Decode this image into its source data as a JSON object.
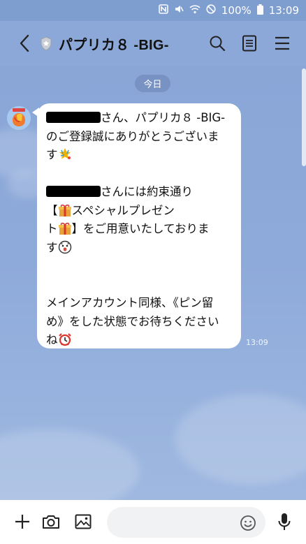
{
  "status_bar": {
    "battery_percent": "100%",
    "time": "13:09",
    "icons": [
      "nfc-icon",
      "mute-icon",
      "wifi-icon",
      "do-not-disturb-icon",
      "battery-icon"
    ]
  },
  "header": {
    "title": "パプリカ８ -BIG-",
    "icons": [
      "back-arrow-icon",
      "shield-icon",
      "search-icon",
      "notes-icon",
      "menu-icon"
    ]
  },
  "chat": {
    "date_label": "今日",
    "message": {
      "lines": [
        "さん、パプリカ８ -BIG-",
        "のご登録誠にありがとうございま",
        "す",
        "",
        "さんには約束通り",
        "【",
        "スペシャルプレゼン",
        "ト",
        "】をご用意いたしておりま",
        "す",
        "",
        "",
        "メインアカウント同様、《ピン留",
        "め》をした状態でお待ちください",
        "ね"
      ],
      "time": "13:09"
    }
  },
  "composer": {
    "input_value": "",
    "icons": [
      "plus-icon",
      "camera-icon",
      "image-icon",
      "emoji-icon",
      "microphone-icon"
    ]
  },
  "colors": {
    "chat_background": "#8fa9d6",
    "bubble": "#ffffff",
    "text": "#111111"
  }
}
